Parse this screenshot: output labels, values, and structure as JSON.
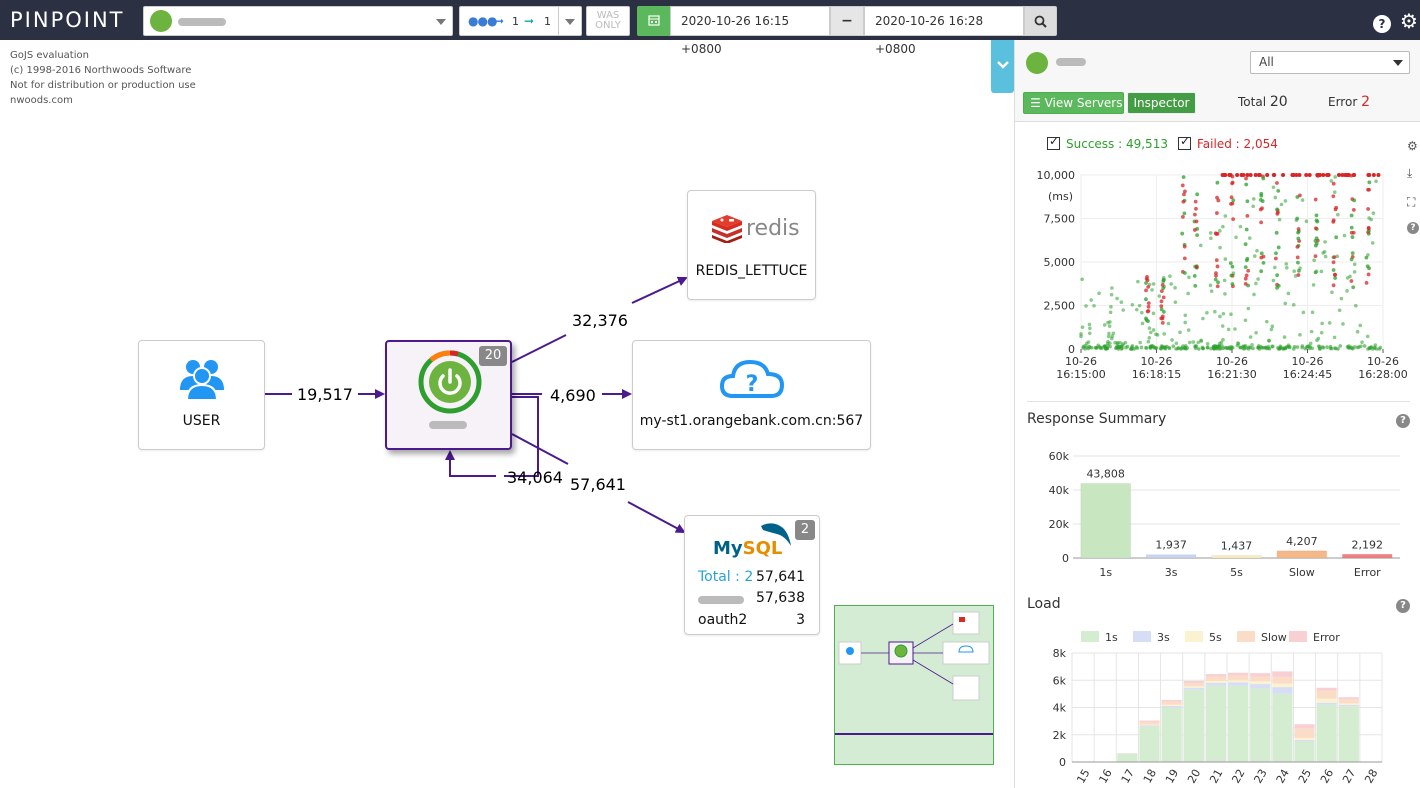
{
  "header": {
    "logo": "PINPOINT",
    "search_depth": {
      "inbound": "1",
      "outbound": "1"
    },
    "was_only": "WAS ONLY",
    "date_from": "2020-10-26 16:15 +0800",
    "date_to": "2020-10-26 16:28 +0800"
  },
  "gojs_note": [
    "GoJS evaluation",
    "(c) 1998-2016 Northwoods Software",
    "Not for distribution or production use",
    "nwoods.com"
  ],
  "map": {
    "user_node": {
      "label": "USER"
    },
    "app_node": {
      "count": "20"
    },
    "redis_node": {
      "brand": "redis",
      "label": "REDIS_LETTUCE"
    },
    "cloud_node": {
      "label": "my-st1.orangebank.com.cn:567"
    },
    "mysql_node": {
      "count": "2",
      "total_label": "Total : 2",
      "total_value": "57,641",
      "row1_value": "57,638",
      "row2_name": "oauth2",
      "row2_value": "3"
    },
    "edges": {
      "user_to_app": "19,517",
      "app_to_redis": "32,376",
      "app_to_cloud": "4,690",
      "app_self": "34,064",
      "app_to_mysql": "57,641"
    }
  },
  "panel": {
    "agent_select": "All",
    "view_servers": "View Servers",
    "inspector": "Inspector",
    "total_label": "Total",
    "total_value": "20",
    "error_label": "Error",
    "error_value": "2",
    "success_legend": "Success : 49,513",
    "failed_legend": "Failed : 2,054",
    "colors": {
      "success": "#2ca02c",
      "failed": "#d62728",
      "accent": "#5cb85c"
    },
    "response_summary_title": "Response Summary",
    "load_title": "Load"
  },
  "chart_data": [
    {
      "type": "scatter",
      "title": "",
      "ylabel": "(ms)",
      "ylim": [
        0,
        10000
      ],
      "y_ticks": [
        "0",
        "2,500",
        "5,000",
        "7,500",
        "10,000"
      ],
      "x_ticks": [
        "10-26 16:15:00",
        "10-26 16:18:15",
        "10-26 16:21:30",
        "10-26 16:24:45",
        "10-26 16:28:00"
      ],
      "series": [
        {
          "name": "Success",
          "count": 49513,
          "color": "#2ca02c"
        },
        {
          "name": "Failed",
          "count": 2054,
          "color": "#d62728"
        }
      ]
    },
    {
      "type": "bar",
      "title": "Response Summary",
      "categories": [
        "1s",
        "3s",
        "5s",
        "Slow",
        "Error"
      ],
      "values": [
        43808,
        1937,
        1437,
        4207,
        2192
      ],
      "labels": [
        "43,808",
        "1,937",
        "1,437",
        "4,207",
        "2,192"
      ],
      "ylim": [
        0,
        60000
      ],
      "y_ticks": [
        "0",
        "20k",
        "40k",
        "60k"
      ],
      "colors": [
        "#c8e6c0",
        "#c8d4f0",
        "#fbeebf",
        "#f7b889",
        "#f08080"
      ]
    },
    {
      "type": "bar",
      "stacked": true,
      "title": "Load",
      "categories": [
        "15",
        "16",
        "17",
        "18",
        "19",
        "20",
        "21",
        "22",
        "23",
        "24",
        "25",
        "26",
        "27",
        "28"
      ],
      "ylim": [
        0,
        8000
      ],
      "y_ticks": [
        "0",
        "2k",
        "4k",
        "6k",
        "8k"
      ],
      "legend": [
        "1s",
        "3s",
        "5s",
        "Slow",
        "Error"
      ],
      "colors": [
        "#d4ecd0",
        "#d6def5",
        "#fbf2cf",
        "#fbdcc6",
        "#f8cfd2"
      ],
      "series": [
        {
          "name": "1s",
          "values": [
            0,
            0,
            600,
            2600,
            4000,
            5300,
            5600,
            5600,
            5400,
            5000,
            1500,
            4200,
            4100,
            0
          ]
        },
        {
          "name": "3s",
          "values": [
            0,
            0,
            20,
            80,
            120,
            150,
            200,
            250,
            320,
            500,
            120,
            150,
            100,
            0
          ]
        },
        {
          "name": "5s",
          "values": [
            0,
            0,
            10,
            60,
            80,
            100,
            150,
            150,
            200,
            250,
            150,
            300,
            100,
            0
          ]
        },
        {
          "name": "Slow",
          "values": [
            0,
            0,
            20,
            200,
            250,
            250,
            300,
            350,
            350,
            500,
            700,
            600,
            300,
            0
          ]
        },
        {
          "name": "Error",
          "values": [
            0,
            0,
            10,
            100,
            100,
            150,
            200,
            200,
            250,
            400,
            300,
            200,
            150,
            0
          ]
        }
      ]
    }
  ]
}
